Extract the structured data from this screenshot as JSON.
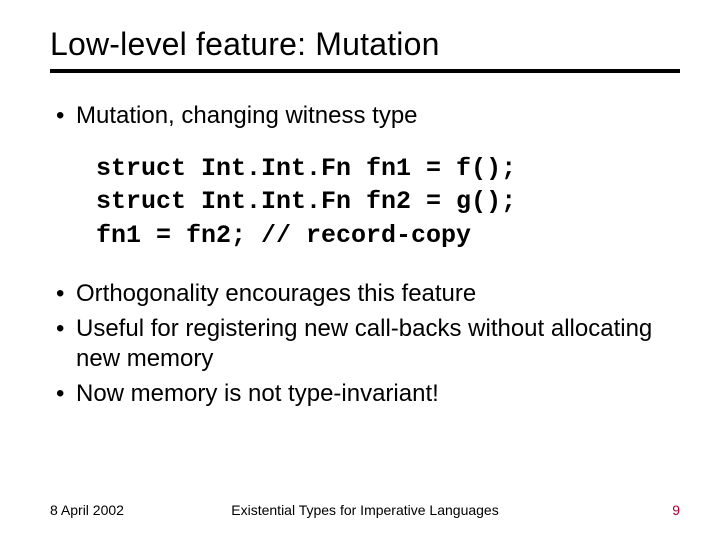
{
  "title": "Low-level feature: Mutation",
  "bullets_top": [
    "Mutation, changing witness type"
  ],
  "code": "struct Int.Int.Fn fn1 = f();\nstruct Int.Int.Fn fn2 = g();\nfn1 = fn2; // record-copy",
  "bullets_bottom": [
    "Orthogonality encourages this feature",
    "Useful for registering new call-backs without allocating new memory",
    "Now memory is not type-invariant!"
  ],
  "footer": {
    "date": "8 April 2002",
    "center": "Existential Types for Imperative Languages",
    "page": "9"
  }
}
